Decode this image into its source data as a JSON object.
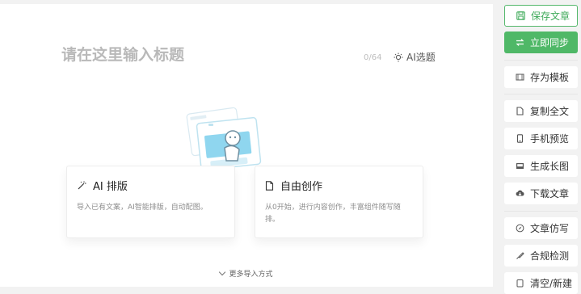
{
  "editor": {
    "title_placeholder": "请在这里输入标题",
    "char_count": "0/64",
    "ai_title_label": "AI选题",
    "cards": [
      {
        "title": "AI 排版",
        "desc": "导入已有文案，AI智能排版，自动配图。"
      },
      {
        "title": "自由创作",
        "desc": "从0开始，进行内容创作，丰富组件随写随排。"
      }
    ],
    "more_import": "更多导入方式"
  },
  "sidebar": {
    "save": "保存文章",
    "sync": "立即同步",
    "template": "存为模板",
    "copy": "复制全文",
    "preview": "手机预览",
    "long_image": "生成长图",
    "download": "下载文章",
    "imitate": "文章仿写",
    "compliance": "合规检测",
    "clear_new": "清空/新建"
  },
  "colors": {
    "accent": "#4fb867",
    "illustration": "#7fd3ee"
  }
}
